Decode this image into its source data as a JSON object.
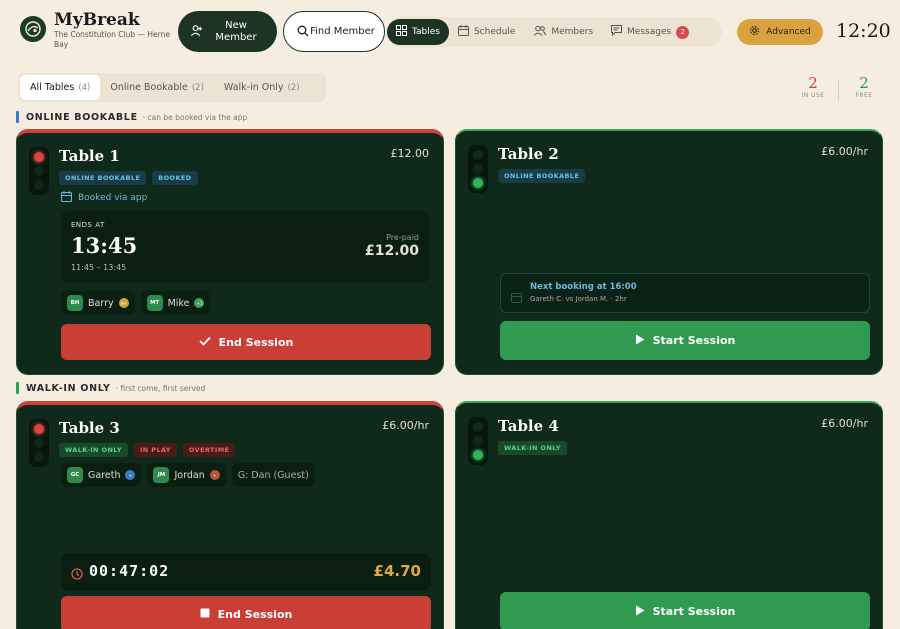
{
  "brand": {
    "name": "MyBreak",
    "subtitle": "The Constitution Club — Herne Bay"
  },
  "header": {
    "new_member": "New Member",
    "find_member": "Find Member",
    "nav": [
      {
        "label": "Tables",
        "icon": "grid-icon",
        "active": true
      },
      {
        "label": "Schedule",
        "icon": "calendar-icon"
      },
      {
        "label": "Members",
        "icon": "users-icon"
      },
      {
        "label": "Messages",
        "icon": "chat-icon",
        "badge": "2"
      }
    ],
    "advanced": "Advanced",
    "clock": "12:20"
  },
  "filters": [
    {
      "label": "All Tables",
      "count": "(4)",
      "active": true
    },
    {
      "label": "Online Bookable",
      "count": "(2)"
    },
    {
      "label": "Walk-in Only",
      "count": "(2)"
    }
  ],
  "stats": {
    "in_use": {
      "value": "2",
      "label": "IN USE",
      "color": "#c9423b"
    },
    "free": {
      "value": "2",
      "label": "FREE",
      "color": "#2f9a50"
    }
  },
  "sections": {
    "online": {
      "title": "ONLINE BOOKABLE",
      "desc": "· can be booked via the app",
      "color": "#3b7bc0"
    },
    "walkin": {
      "title": "WALK-IN ONLY",
      "desc": "· first come, first served",
      "color": "#2f9a50"
    }
  },
  "tables": {
    "t1": {
      "title": "Table 1",
      "price": "£12.00",
      "chips": [
        "ONLINE BOOKABLE",
        "BOOKED"
      ],
      "booked_via": "Booked via app",
      "ends_label": "ENDS AT",
      "ends_time": "13:45",
      "range": "11:45 – 13:45",
      "prepaid_label": "Pre-paid",
      "prepaid_amount": "£12.00",
      "players": [
        {
          "initials": "BH",
          "name": "Barry",
          "tag": "A+"
        },
        {
          "initials": "MT",
          "name": "Mike",
          "tag": "+1"
        }
      ],
      "action": "End Session"
    },
    "t2": {
      "title": "Table 2",
      "price": "£6.00/hr",
      "chips": [
        "ONLINE BOOKABLE"
      ],
      "next_title": "Next booking at 16:00",
      "next_sub": "Gareth C. vs Jordan M. · 2hr",
      "action": "Start Session"
    },
    "t3": {
      "title": "Table 3",
      "price": "£6.00/hr",
      "chips": [
        "WALK-IN ONLY",
        "IN PLAY",
        "OVERTIME"
      ],
      "players": [
        {
          "initials": "GC",
          "name": "Gareth",
          "tag": "+"
        },
        {
          "initials": "JM",
          "name": "Jordan",
          "tag": "+"
        }
      ],
      "guest": "G: Dan (Guest)",
      "timer": "00:47:02",
      "amount": "£4.70",
      "action": "End Session"
    },
    "t4": {
      "title": "Table 4",
      "price": "£6.00/hr",
      "chips": [
        "WALK-IN ONLY"
      ],
      "action": "Start Session"
    }
  }
}
